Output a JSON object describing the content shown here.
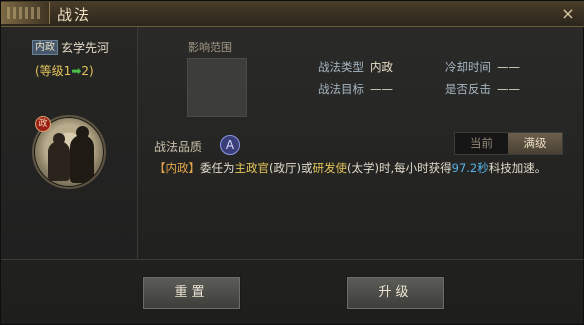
{
  "window": {
    "title": "战法",
    "close_glyph": "×"
  },
  "skill": {
    "type_tag": "内政",
    "name": "玄学先河",
    "level_prefix": "(等级1",
    "level_arrow": "➡",
    "level_suffix": "2)",
    "portrait_badge": "政"
  },
  "area": {
    "label": "影响范围"
  },
  "info": {
    "type_label": "战法类型",
    "type_value": "内政",
    "cooldown_label": "冷却时间",
    "cooldown_value": "——",
    "target_label": "战法目标",
    "target_value": "——",
    "counter_label": "是否反击",
    "counter_value": "——"
  },
  "quality": {
    "label": "战法品质",
    "grade": "A"
  },
  "toggle": {
    "current_label": "当前",
    "max_label": "满级",
    "selected": "满级"
  },
  "description": {
    "tag": "【内政】",
    "part1": "委任为",
    "hl1": "主政官",
    "part2": "(政厅)或",
    "hl2": "研发使",
    "part3": "(太学)时,每小时获得",
    "value": "97.2秒",
    "part4": "科技加速。"
  },
  "buttons": {
    "reset": "重置",
    "upgrade": "升级"
  }
}
